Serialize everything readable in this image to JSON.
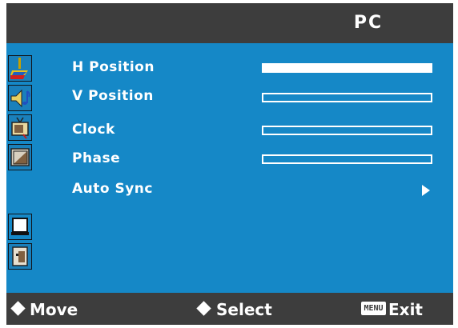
{
  "header": {
    "title": "PC"
  },
  "sidebar": {
    "items": [
      {
        "icon": "picture-icon"
      },
      {
        "icon": "sound-icon"
      },
      {
        "icon": "channel-icon"
      },
      {
        "icon": "screen-icon"
      },
      {
        "icon": "pc-icon",
        "selected": true
      },
      {
        "icon": "setup-icon"
      }
    ]
  },
  "menu": {
    "items": [
      {
        "label": "H Position",
        "level": 1.0
      },
      {
        "label": "V Position",
        "level": 0.0
      },
      {
        "label": "Clock",
        "level": 0.0
      },
      {
        "label": "Phase",
        "level": 0.0
      },
      {
        "label": "Auto Sync",
        "submenu": true
      }
    ]
  },
  "footer": {
    "move": "Move",
    "select": "Select",
    "menu_key": "MENU",
    "exit": "Exit"
  },
  "colors": {
    "panel": "#1588c7",
    "bar": "#3d3d3d",
    "text": "#ffffff"
  }
}
